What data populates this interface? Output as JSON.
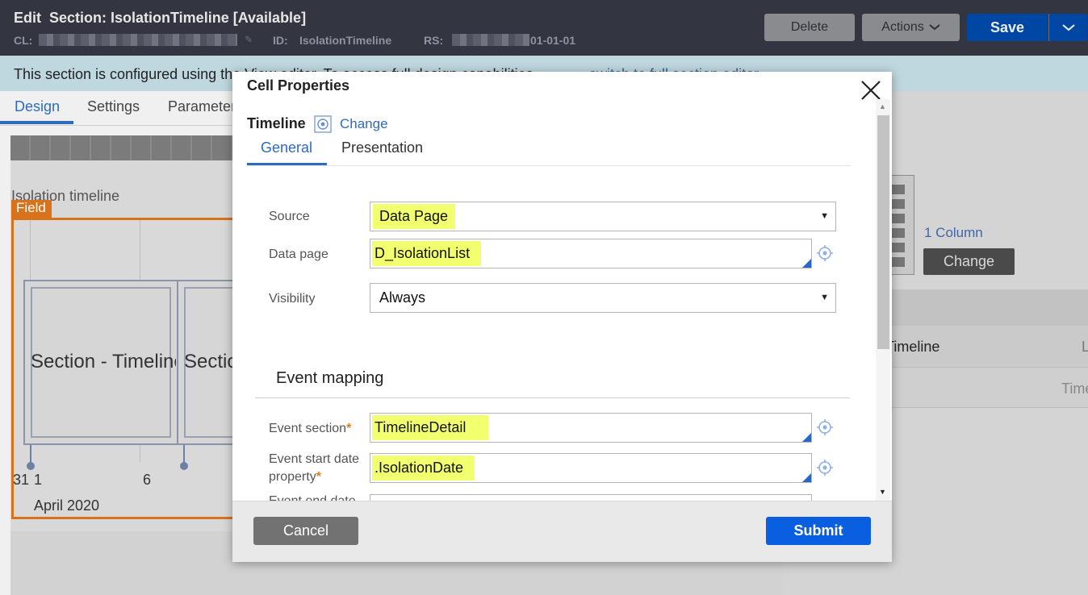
{
  "header": {
    "title": "Edit  Section: IsolationTimeline [Available]",
    "cl_label": "CL:",
    "id_label": "ID:",
    "id_value": "IsolationTimeline",
    "rs_label": "RS:",
    "rs_value_visible": "01-01-01",
    "delete_label": "Delete",
    "actions_label": "Actions",
    "save_label": "Save"
  },
  "infobar": {
    "text": "This section is configured using the View editor. To access full design capabilities,",
    "link_text": "switch to full section editor"
  },
  "page_tabs": [
    "Design",
    "Settings",
    "Parameters"
  ],
  "canvas": {
    "section_label": "Isolation timeline",
    "field_tag": "Field",
    "section_texts": [
      "Section - Timeline",
      "Section - Timeline"
    ],
    "ticks": [
      "31",
      "1",
      "6"
    ],
    "month": "April 2020"
  },
  "right_panel": {
    "one_column": "1 Column",
    "change_label": "Change",
    "row_text": "Timeline",
    "row_text_suffix": "L",
    "row2_text": "Time"
  },
  "modal": {
    "title": "Cell Properties",
    "control_type": "Timeline",
    "change_link": "Change",
    "tabs": [
      "General",
      "Presentation"
    ],
    "active_tab": "General",
    "fields": {
      "source": {
        "label": "Source",
        "value": "Data Page"
      },
      "data_page": {
        "label": "Data page",
        "value": "D_IsolationList"
      },
      "visibility": {
        "label": "Visibility",
        "value": "Always"
      }
    },
    "event_mapping": {
      "heading": "Event mapping",
      "event_section": {
        "label": "Event section",
        "value": "TimelineDetail"
      },
      "event_start": {
        "label_line1": "Event start date",
        "label_line2": "property",
        "value": ".IsolationDate"
      },
      "event_end": {
        "label": "Event end date",
        "value": ""
      }
    },
    "required_mark": "*",
    "cancel_label": "Cancel",
    "submit_label": "Submit"
  },
  "colors": {
    "header_bg": "#333541",
    "save_blue": "#0047a3",
    "submit_blue": "#0a5fe0",
    "highlight": "#f2ff6f",
    "field_orange": "#d9721c",
    "link_blue": "#2e6bba"
  }
}
